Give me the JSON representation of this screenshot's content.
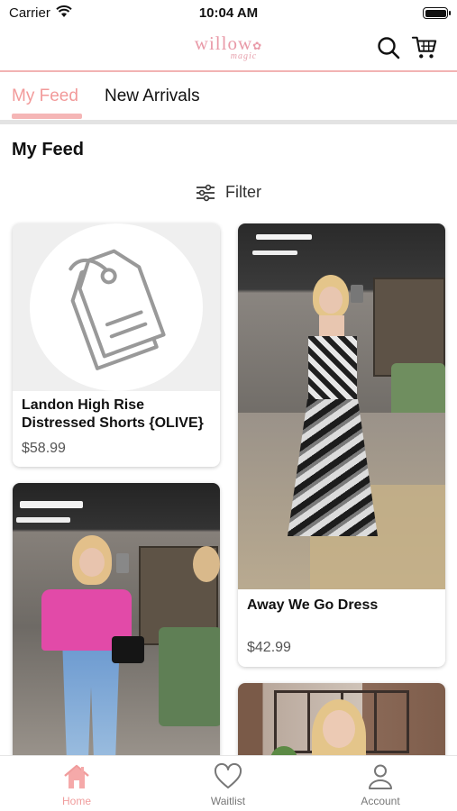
{
  "status_bar": {
    "carrier": "Carrier",
    "time": "10:04 AM"
  },
  "header": {
    "logo_main": "willow",
    "logo_sub": "magic"
  },
  "tabs": [
    {
      "label": "My Feed",
      "active": true
    },
    {
      "label": "New Arrivals",
      "active": false
    }
  ],
  "section": {
    "title": "My Feed",
    "filter_label": "Filter"
  },
  "products": [
    {
      "title": "Landon High Rise Distressed Shorts {OLIVE}",
      "price": "$58.99",
      "image": "tag-placeholder-icon"
    },
    {
      "title": "Away We Go Dress",
      "price": "$42.99",
      "image": "dress-photo"
    },
    {
      "title": "",
      "price": "",
      "image": "pink-tee-photo"
    },
    {
      "title": "",
      "price": "",
      "image": "outfit-photo"
    }
  ],
  "bottom_nav": [
    {
      "label": "Home",
      "icon": "home-icon",
      "active": true
    },
    {
      "label": "Waitlist",
      "icon": "heart-icon",
      "active": false
    },
    {
      "label": "Account",
      "icon": "user-icon",
      "active": false
    }
  ],
  "colors": {
    "accent": "#f29a9a",
    "divider": "#f2b3b3"
  }
}
